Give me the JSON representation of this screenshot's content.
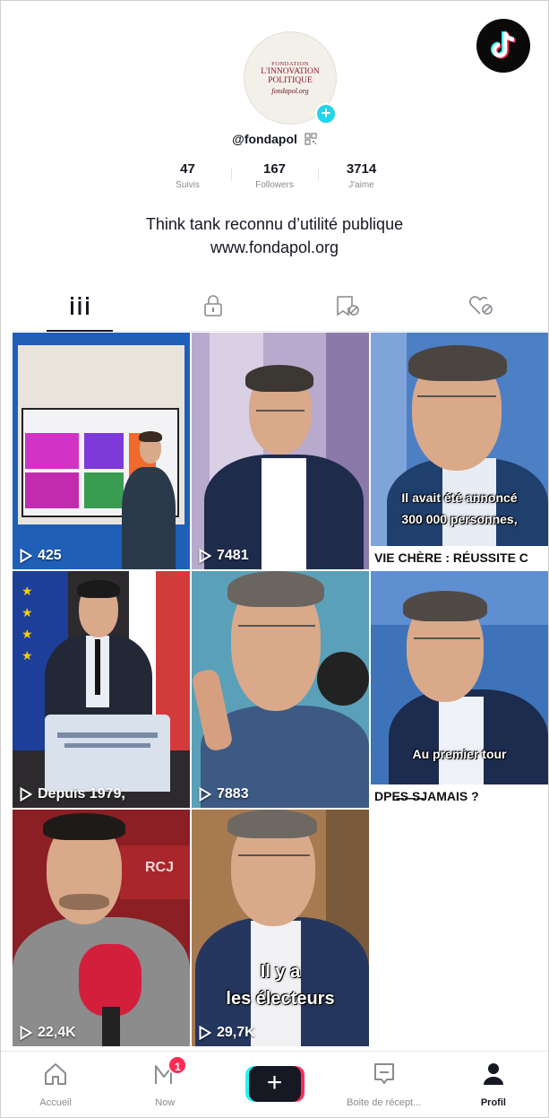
{
  "profile": {
    "avatar_text": [
      "FONDATION",
      "L'INNOVATION",
      "POLITIQUE",
      "fondapol.org"
    ],
    "handle": "@fondapol",
    "bio_line1": "Think tank reconnu d’utilité publique",
    "bio_line2": "www.fondapol.org"
  },
  "stats": [
    {
      "value": "47",
      "label": "Suivis"
    },
    {
      "value": "167",
      "label": "Followers"
    },
    {
      "value": "3714",
      "label": "J'aime"
    }
  ],
  "tabs": [
    {
      "icon": "videos-grid-icon"
    },
    {
      "icon": "private-lock-icon"
    },
    {
      "icon": "reposts-icon"
    },
    {
      "icon": "liked-heart-icon"
    }
  ],
  "videos": [
    {
      "views": "425",
      "caption": "",
      "strip": ""
    },
    {
      "views": "7481",
      "caption": "",
      "strip": ""
    },
    {
      "views": "",
      "caption": "Il avait été annoncé\n300 000 personnes,",
      "strip": "VIE CHÈRE : RÉUSSITE C"
    },
    {
      "views": "Depuis 1979,",
      "caption": "",
      "strip": ""
    },
    {
      "views": "7883",
      "caption": "",
      "strip": ""
    },
    {
      "views": "",
      "caption": "Au premier tour",
      "strip": "DPE̶S̶ ̶S̶JAMAIS ?"
    },
    {
      "views": "22,4K",
      "caption": "",
      "strip": ""
    },
    {
      "views": "29,7K",
      "caption": "Il y a\nles électeurs",
      "strip": ""
    }
  ],
  "nav": {
    "home": "Accueil",
    "now": "Now",
    "now_badge": "1",
    "inbox": "Boite de récept...",
    "profile": "Profil"
  },
  "colors": {
    "accent_cyan": "#20d5ec",
    "accent_red": "#fe2c55",
    "text_primary": "#161823",
    "text_secondary": "#8a8b91"
  }
}
